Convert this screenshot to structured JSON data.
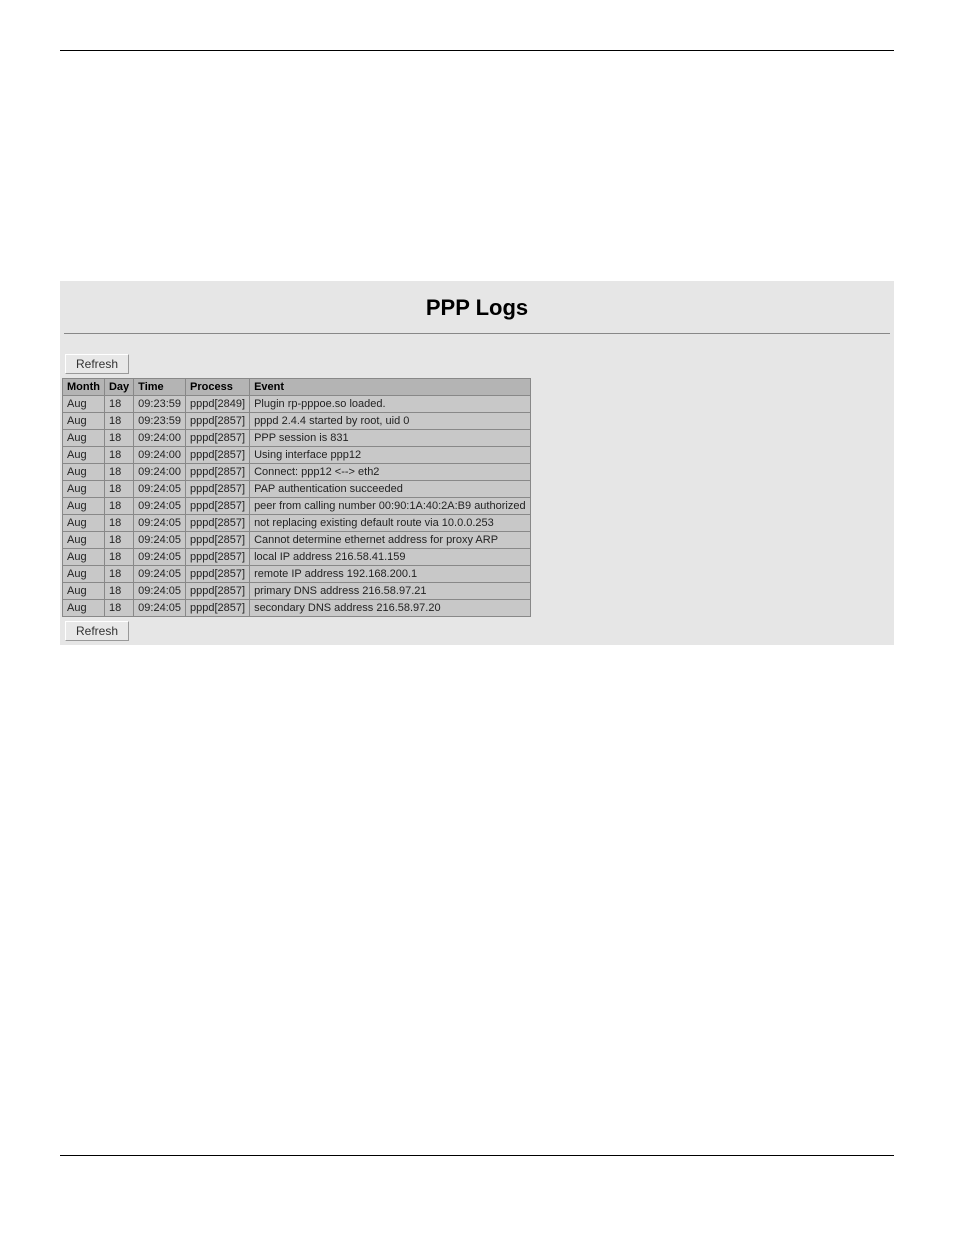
{
  "page_title": "PPP Logs",
  "refresh_label": "Refresh",
  "columns": {
    "month": "Month",
    "day": "Day",
    "time": "Time",
    "process": "Process",
    "event": "Event"
  },
  "rows": [
    {
      "month": "Aug",
      "day": "18",
      "time": "09:23:59",
      "process": "pppd[2849]",
      "event": "Plugin rp-pppoe.so loaded."
    },
    {
      "month": "Aug",
      "day": "18",
      "time": "09:23:59",
      "process": "pppd[2857]",
      "event": "pppd 2.4.4 started by root, uid 0"
    },
    {
      "month": "Aug",
      "day": "18",
      "time": "09:24:00",
      "process": "pppd[2857]",
      "event": "PPP session is 831"
    },
    {
      "month": "Aug",
      "day": "18",
      "time": "09:24:00",
      "process": "pppd[2857]",
      "event": "Using interface ppp12"
    },
    {
      "month": "Aug",
      "day": "18",
      "time": "09:24:00",
      "process": "pppd[2857]",
      "event": "Connect: ppp12 <--> eth2"
    },
    {
      "month": "Aug",
      "day": "18",
      "time": "09:24:05",
      "process": "pppd[2857]",
      "event": "PAP authentication succeeded"
    },
    {
      "month": "Aug",
      "day": "18",
      "time": "09:24:05",
      "process": "pppd[2857]",
      "event": "peer from calling number 00:90:1A:40:2A:B9 authorized"
    },
    {
      "month": "Aug",
      "day": "18",
      "time": "09:24:05",
      "process": "pppd[2857]",
      "event": "not replacing existing default route via 10.0.0.253"
    },
    {
      "month": "Aug",
      "day": "18",
      "time": "09:24:05",
      "process": "pppd[2857]",
      "event": "Cannot determine ethernet address for proxy ARP"
    },
    {
      "month": "Aug",
      "day": "18",
      "time": "09:24:05",
      "process": "pppd[2857]",
      "event": "local IP address 216.58.41.159"
    },
    {
      "month": "Aug",
      "day": "18",
      "time": "09:24:05",
      "process": "pppd[2857]",
      "event": "remote IP address 192.168.200.1"
    },
    {
      "month": "Aug",
      "day": "18",
      "time": "09:24:05",
      "process": "pppd[2857]",
      "event": "primary DNS address 216.58.97.21"
    },
    {
      "month": "Aug",
      "day": "18",
      "time": "09:24:05",
      "process": "pppd[2857]",
      "event": "secondary DNS address 216.58.97.20"
    }
  ]
}
